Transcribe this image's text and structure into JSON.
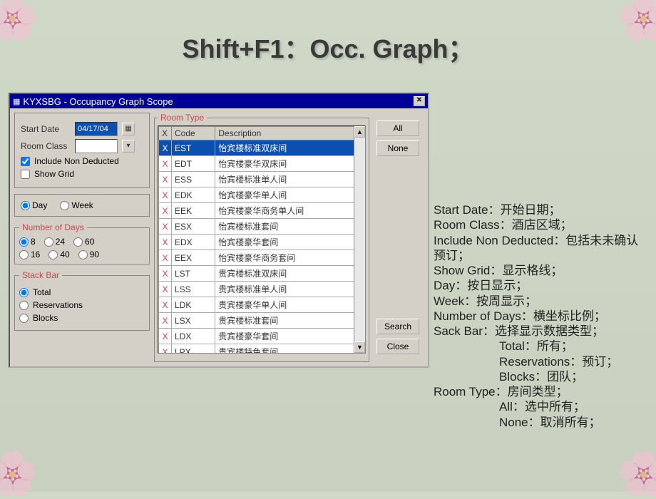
{
  "slide": {
    "title": "Shift+F1：Occ. Graph；"
  },
  "window": {
    "title": "KYXSBG - Occupancy Graph Scope"
  },
  "form": {
    "start_date_label": "Start Date",
    "start_date_value": "04/17/04",
    "room_class_label": "Room Class",
    "room_class_value": "",
    "include_non_deducted": "Include Non Deducted",
    "show_grid": "Show Grid",
    "period": {
      "day": "Day",
      "week": "Week"
    },
    "num_days": {
      "legend": "Number of Days",
      "opts": [
        "8",
        "24",
        "60",
        "16",
        "40",
        "90"
      ]
    },
    "stack_bar": {
      "legend": "Stack Bar",
      "total": "Total",
      "reservations": "Reservations",
      "blocks": "Blocks"
    }
  },
  "room_type": {
    "legend": "Room Type",
    "cols": {
      "x": "X",
      "code": "Code",
      "desc": "Description"
    },
    "rows": [
      {
        "x": "X",
        "code": "EST",
        "desc": "怡宾楼标准双床间",
        "selected": true
      },
      {
        "x": "X",
        "code": "EDT",
        "desc": "怡宾楼豪华双床间"
      },
      {
        "x": "X",
        "code": "ESS",
        "desc": "怡宾楼标准单人间"
      },
      {
        "x": "X",
        "code": "EDK",
        "desc": "怡宾楼豪华单人间"
      },
      {
        "x": "X",
        "code": "EEK",
        "desc": "怡宾楼豪华商务单人间"
      },
      {
        "x": "X",
        "code": "ESX",
        "desc": "怡宾楼标准套间"
      },
      {
        "x": "X",
        "code": "EDX",
        "desc": "怡宾楼豪华套间"
      },
      {
        "x": "X",
        "code": "EEX",
        "desc": "怡宾楼豪华商务套间"
      },
      {
        "x": "X",
        "code": "LST",
        "desc": "贵宾楼标准双床间"
      },
      {
        "x": "X",
        "code": "LSS",
        "desc": "贵宾楼标准单人间"
      },
      {
        "x": "X",
        "code": "LDK",
        "desc": "贵宾楼豪华单人间"
      },
      {
        "x": "X",
        "code": "LSX",
        "desc": "贵宾楼标准套间"
      },
      {
        "x": "X",
        "code": "LDX",
        "desc": "贵宾楼豪华套间"
      },
      {
        "x": "X",
        "code": "LPX",
        "desc": "贵宾楼特色套间"
      }
    ]
  },
  "buttons": {
    "all": "All",
    "none": "None",
    "search": "Search",
    "close": "Close"
  },
  "explanations": {
    "lines": [
      "Start Date：开始日期；",
      "Room Class：酒店区域；",
      "Include Non Deducted：包括未未确认预订；",
      "Show Grid：显示格线；",
      "Day：按日显示；",
      "Week：按周显示；",
      "Number of Days：横坐标比例；",
      "Sack Bar：选择显示数据类型；"
    ],
    "indent1": [
      "Total：所有；",
      "Reservations：预订；",
      "Blocks：团队；"
    ],
    "line_roomtype": "Room Type：房间类型；",
    "indent2": [
      "All：选中所有；",
      "None：取消所有；"
    ]
  }
}
